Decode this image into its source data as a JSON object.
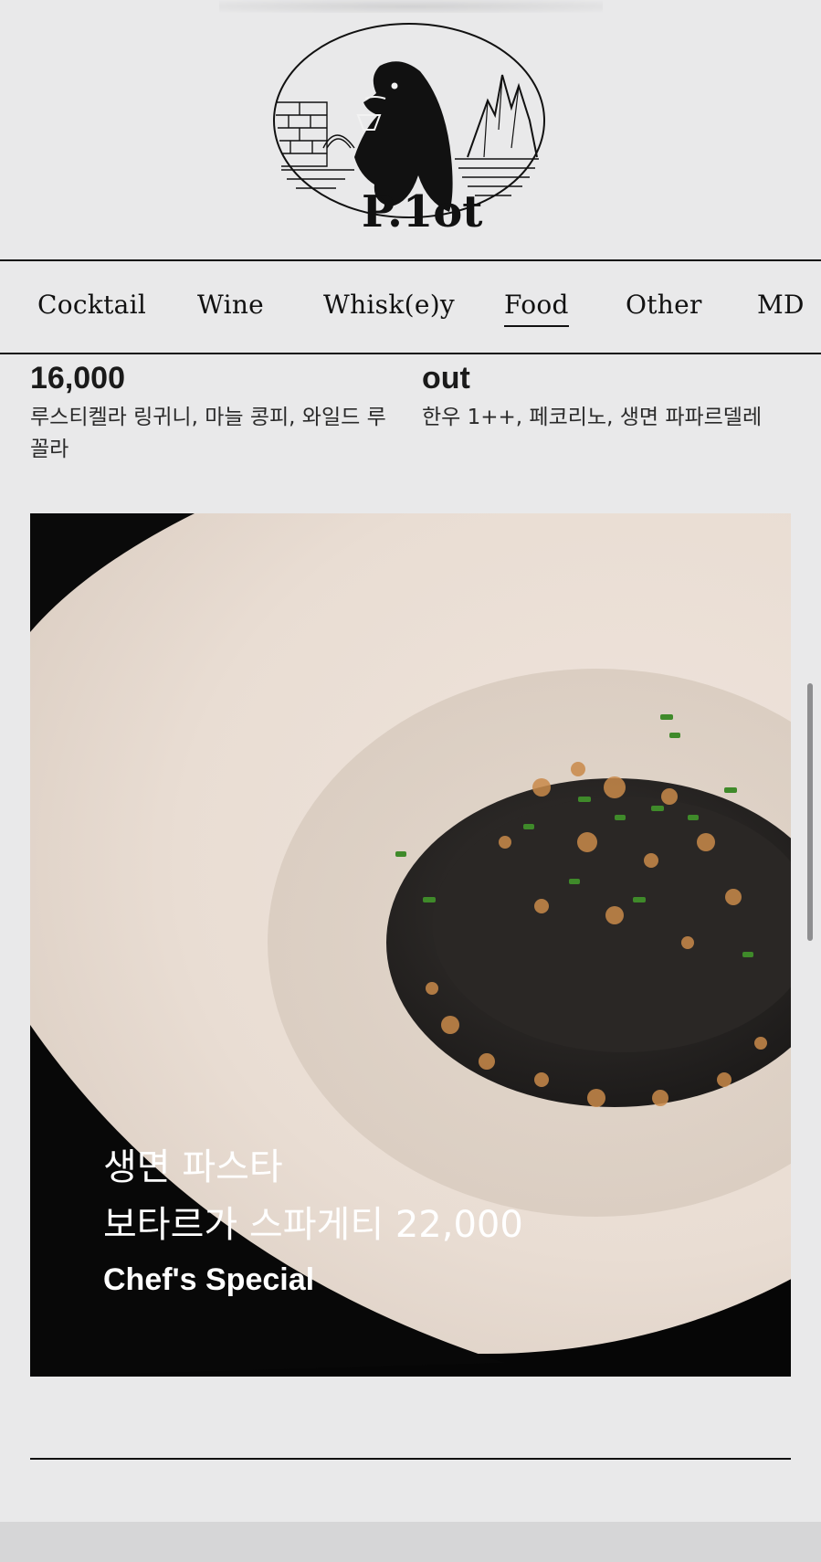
{
  "brand": {
    "logo_text": "P.1ot"
  },
  "nav": {
    "items": [
      {
        "label": "Cocktail"
      },
      {
        "label": "Wine"
      },
      {
        "label": "Whisk(e)y"
      },
      {
        "label": "Food",
        "active": true
      },
      {
        "label": "Other"
      },
      {
        "label": "MD"
      }
    ]
  },
  "menu_items": [
    {
      "price": "16,000",
      "description": "루스티켈라 링귀니, 마늘 콩피, 와일드 루꼴라"
    },
    {
      "price": "out",
      "description": "한우 1++, 페코리노, 생면 파파르델레"
    }
  ],
  "feature": {
    "name": "생면 파스타",
    "subtitle": "보타르가 스파게티 22,000",
    "tag": "Chef's Special"
  },
  "colors": {
    "background": "#e9e9ea",
    "text": "#111111",
    "caption": "#ffffff"
  }
}
